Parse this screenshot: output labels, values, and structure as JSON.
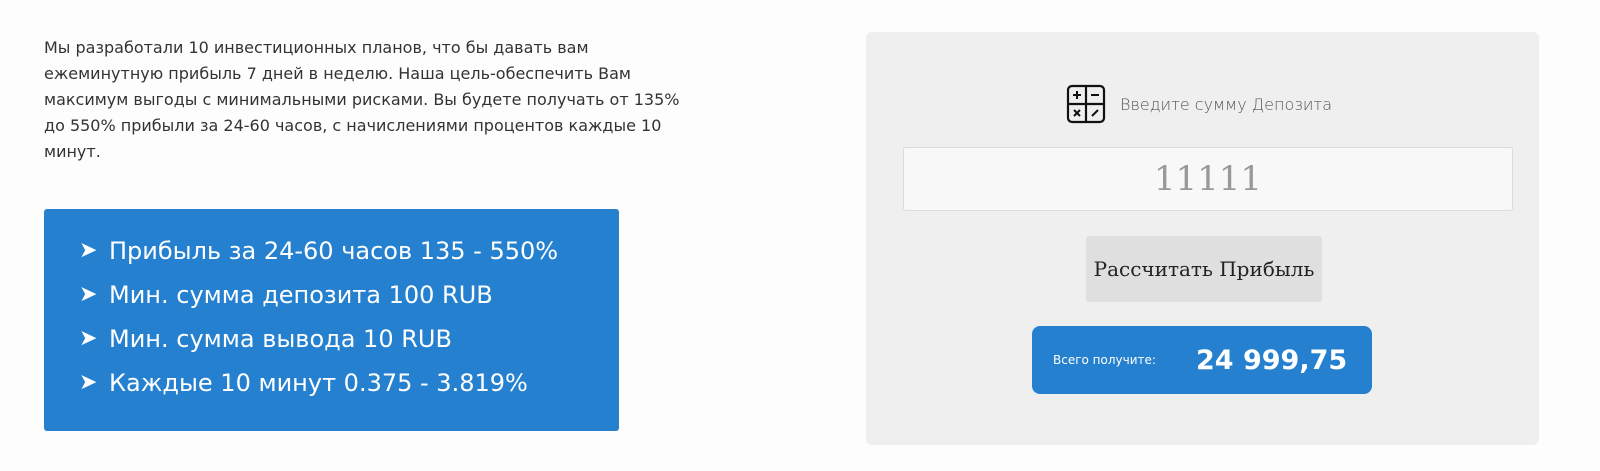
{
  "intro": {
    "text": "Мы разработали 10 инвестиционных планов, что бы давать вам ежеминутную прибыль 7 дней в неделю. Наша цель-обеспечить Вам максимум выгоды с минимальными рисками. Вы будете получать от 135% до 550% прибыли за 24-60 часов, с начислениями процентов каждые 10 минут."
  },
  "features": {
    "arrow": "➤",
    "items": [
      "Прибыль за 24-60 часов 135 - 550%",
      "Мин. сумма депозита 100 RUB",
      "Мин. сумма вывода 10 RUB",
      "Каждые 10 минут 0.375 - 3.819%"
    ]
  },
  "calculator": {
    "icon": "calculator-icon",
    "label": "Введите сумму Депозита",
    "input_value": "11111",
    "button_label": "Рассчитать Прибыль",
    "result_label": "Всего получите:",
    "result_value": "24 999,75"
  },
  "colors": {
    "accent": "#2580cf",
    "panel": "#efefef"
  }
}
